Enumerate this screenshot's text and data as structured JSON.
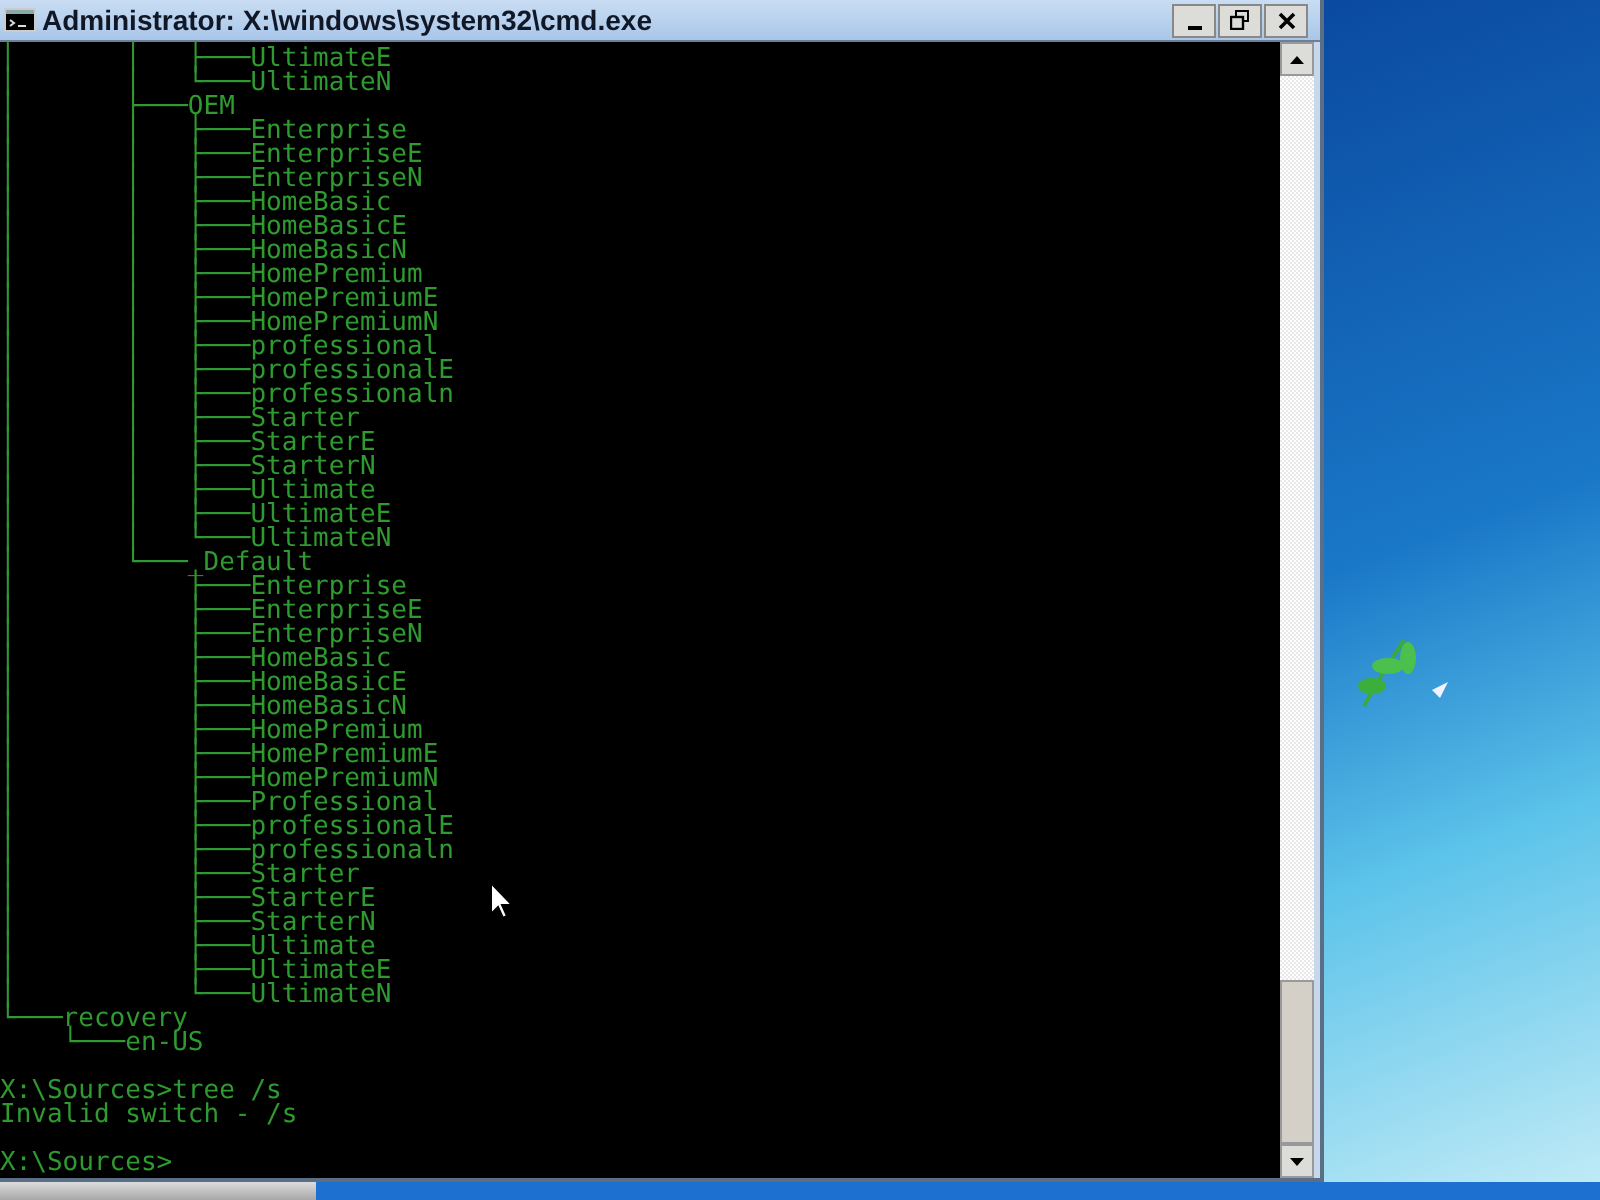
{
  "window": {
    "title": "Administrator: X:\\windows\\system32\\cmd.exe"
  },
  "console": {
    "blocks": [
      {
        "lines": [
          "│       │   ├───UltimateE",
          "│       │   └───UltimateN",
          "│       ├───OEM",
          "│       │   ├───Enterprise",
          "│       │   ├───EnterpriseE",
          "│       │   ├───EnterpriseN",
          "│       │   ├───HomeBasic",
          "│       │   ├───HomeBasicE",
          "│       │   ├───HomeBasicN",
          "│       │   ├───HomePremium",
          "│       │   ├───HomePremiumE",
          "│       │   ├───HomePremiumN",
          "│       │   ├───professional",
          "│       │   ├───professionalE",
          "│       │   ├───professionaln",
          "│       │   ├───Starter",
          "│       │   ├───StarterE",
          "│       │   ├───StarterN",
          "│       │   ├───Ultimate",
          "│       │   ├───UltimateE",
          "│       │   └───UltimateN",
          "│       └───_Default",
          "│           ├───Enterprise",
          "│           ├───EnterpriseE",
          "│           ├───EnterpriseN",
          "│           ├───HomeBasic",
          "│           ├───HomeBasicE",
          "│           ├───HomeBasicN",
          "│           ├───HomePremium",
          "│           ├───HomePremiumE",
          "│           ├───HomePremiumN",
          "│           ├───Professional",
          "│           ├───professionalE",
          "│           ├───professionaln",
          "│           ├───Starter",
          "│           ├───StarterE",
          "│           ├───StarterN",
          "│           ├───Ultimate",
          "│           ├───UltimateE",
          "│           └───UltimateN",
          "└───recovery",
          "    └───en-US"
        ]
      },
      {
        "lines": [
          "X:\\Sources>tree /s",
          "Invalid switch - /s"
        ]
      },
      {
        "lines": [
          "X:\\Sources>"
        ]
      }
    ]
  }
}
